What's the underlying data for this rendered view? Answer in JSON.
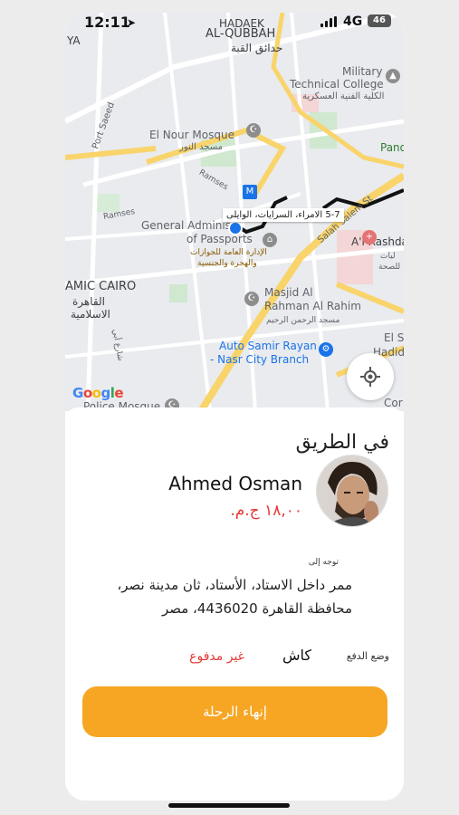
{
  "status_bar": {
    "time": "12:11",
    "network": "4G",
    "battery": "46"
  },
  "map": {
    "labels": {
      "al_qubbah": "AL-QUBBAH",
      "hadaek": "HADAEK",
      "al_qubbah_ar": "حدائق القبة",
      "ya": "YA",
      "military1": "Military",
      "military2": "Technical College",
      "military_ar": "الكلية الفنية العسكرية",
      "port_saeed": "Port Saeed",
      "el_nour": "El Nour Mosque",
      "el_nour_ar": "مسجد النور",
      "ramses": "Ramses",
      "ramses2": "Ramses",
      "general1": "General Adminis",
      "general2": "of Passports",
      "general_ar1": "الإدارة العامة للجوازات",
      "general_ar2": "والهجرة والجنسية",
      "salah": "Salah Salem St",
      "rashda": "A'l Rashda",
      "rashda_ar": "ليات",
      "rashda_ar2": "للصحة",
      "cairo": "AMIC CAIRO",
      "cairo_ar1": "القاهرة",
      "cairo_ar2": "الاسلامية",
      "masjid1": "Masjid Al",
      "masjid2": "Rahman Al Rahim",
      "masjid_ar": "مسجد الرحمن الرحيم",
      "auto1": "Auto Samir Rayan",
      "auto2": "- Nasr City Branch",
      "panorama": "Pano",
      "el_se": "El Se",
      "hadid": "Hadid S",
      "cor": "Cor",
      "police": "Police Mosque",
      "street_ar": "شارع أبي",
      "google": "Google"
    },
    "callout": "5-7 الامراء، السرايات، الوايلى"
  },
  "trip": {
    "status_title": "في الطريق",
    "driver_name": "Ahmed Osman",
    "fare": "١٨,٠٠ ج.م.",
    "destination_label": "توجه إلى",
    "destination": "ممر داخل الاستاد، الأستاد، ثان مدينة نصر، محافظة القاهرة 4436020، مصر",
    "payment_label": "وضع الدفع",
    "payment_method": "كاش",
    "payment_status": "غير مدفوع",
    "end_button": "إنهاء الرحلة"
  },
  "colors": {
    "accent": "#f6a623",
    "price_red": "#e53935",
    "route": "#111111"
  }
}
